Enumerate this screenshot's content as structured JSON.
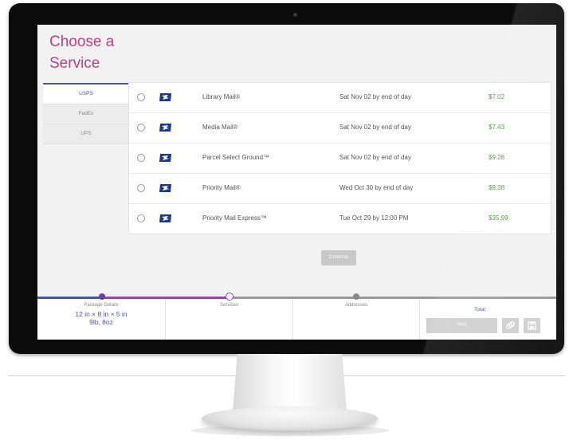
{
  "page": {
    "title": "Choose a Service"
  },
  "carriers": [
    {
      "label": "USPS",
      "active": true
    },
    {
      "label": "FedEx",
      "active": false
    },
    {
      "label": "UPS",
      "active": false
    }
  ],
  "services": [
    {
      "name": "Library Mail®",
      "delivery": "Sat Nov 02 by end of day",
      "price": "$7.02"
    },
    {
      "name": "Media Mail®",
      "delivery": "Sat Nov 02 by end of day",
      "price": "$7.43"
    },
    {
      "name": "Parcel Select Ground™",
      "delivery": "Sat Nov 02 by end of day",
      "price": "$9.28"
    },
    {
      "name": "Priority Mail®",
      "delivery": "Wed Oct 30 by end of day",
      "price": "$9.38"
    },
    {
      "name": "Priority Mail Express™",
      "delivery": "Tue Oct 29 by 12:00 PM",
      "price": "$35.99"
    }
  ],
  "actions": {
    "continue_label": "Continue",
    "print_label": "Print"
  },
  "footer": {
    "steps": [
      {
        "label": "Package Details",
        "value_line1": "12 in × 8 in × 5 in",
        "value_line2": "9lb, 8oz"
      },
      {
        "label": "Services"
      },
      {
        "label": "Addresses"
      }
    ],
    "total_label": "Total:"
  },
  "colors": {
    "title": "#c2407e",
    "accent": "#4a55a2",
    "progress_purple": "#6b3fa0",
    "price_green": "#4a9a3a"
  },
  "icons": {
    "carrier_logo": "usps-eagle-icon",
    "icon_button_1": "copy-icon",
    "icon_button_2": "save-icon"
  }
}
